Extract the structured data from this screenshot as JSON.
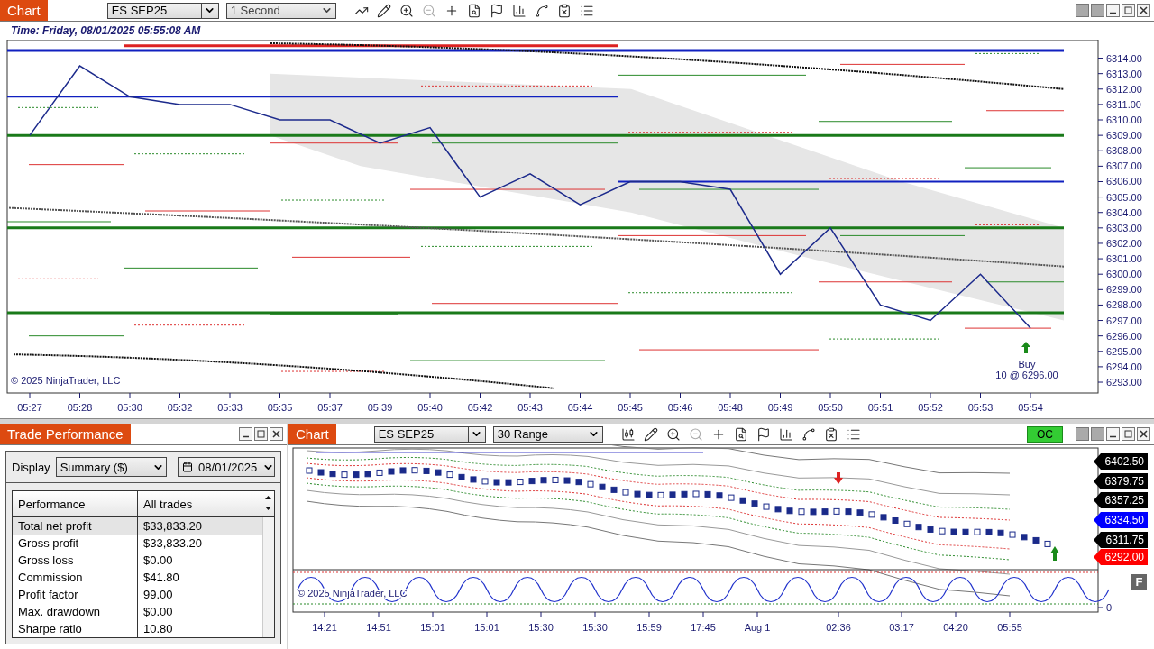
{
  "top_chart": {
    "tab": "Chart",
    "instrument": "ES SEP25",
    "interval": "1 Second",
    "time_label": "Time: Friday, 08/01/2025 05:55:08 AM",
    "copyright": "© 2025 NinjaTrader, LLC",
    "marker": {
      "label": "Buy",
      "detail": "10 @ 6296.00"
    },
    "chart_data": {
      "type": "line",
      "categories": [
        "05:27",
        "05:28",
        "05:30",
        "05:32",
        "05:33",
        "05:35",
        "05:37",
        "05:39",
        "05:40",
        "05:42",
        "05:43",
        "05:44",
        "05:45",
        "05:46",
        "05:48",
        "05:49",
        "05:50",
        "05:51",
        "05:52",
        "05:53",
        "05:54"
      ],
      "series": [
        {
          "color": "#1c2a8c",
          "values": [
            6309,
            6313.5,
            6311.5,
            6311,
            6311,
            6310,
            6310,
            6308.5,
            6309.5,
            6305,
            6306.5,
            6304.5,
            6306,
            6306,
            6305.5,
            6300,
            6303,
            6298,
            6297,
            6300,
            6296.5
          ]
        }
      ],
      "ylim": [
        6292.3,
        6315.2
      ],
      "yticks": [
        {
          "value": 6314,
          "label": "6314.00"
        },
        {
          "value": 6313,
          "label": "6313.00"
        },
        {
          "value": 6312,
          "label": "6312.00"
        },
        {
          "value": 6311,
          "label": "6311.00"
        },
        {
          "value": 6310,
          "label": "6310.00"
        },
        {
          "value": 6309,
          "label": "6309.00"
        },
        {
          "value": 6308,
          "label": "6308.00"
        },
        {
          "value": 6307,
          "label": "6307.00"
        },
        {
          "value": 6306,
          "label": "6306.00"
        },
        {
          "value": 6305,
          "label": "6305.00"
        },
        {
          "value": 6304,
          "label": "6304.00"
        },
        {
          "value": 6303,
          "label": "6303.00"
        },
        {
          "value": 6302,
          "label": "6302.00"
        },
        {
          "value": 6301,
          "label": "6301.00"
        },
        {
          "value": 6300,
          "label": "6300.00"
        },
        {
          "value": 6299,
          "label": "6299.00"
        },
        {
          "value": 6298,
          "label": "6298.00"
        },
        {
          "value": 6297,
          "label": "6297.00"
        },
        {
          "value": 6296,
          "label": "6296.00"
        },
        {
          "value": 6295,
          "label": "6295.00"
        },
        {
          "value": 6294,
          "label": "6294.00"
        },
        {
          "value": 6293,
          "label": "6293.00"
        }
      ]
    }
  },
  "performance": {
    "title": "Trade Performance",
    "display_label": "Display",
    "display_value": "Summary ($)",
    "date": "08/01/2025",
    "columns": [
      "Performance",
      "All trades"
    ],
    "rows": [
      {
        "label": "Total net profit",
        "value": "$33,833.20",
        "selected": true
      },
      {
        "label": "Gross profit",
        "value": "$33,833.20",
        "selected": false
      },
      {
        "label": "Gross loss",
        "value": "$0.00",
        "selected": false
      },
      {
        "label": "Commission",
        "value": "$41.80",
        "selected": false
      },
      {
        "label": "Profit factor",
        "value": "99.00",
        "selected": false
      },
      {
        "label": "Max. drawdown",
        "value": "$0.00",
        "selected": false
      },
      {
        "label": "Sharpe ratio",
        "value": "10.80",
        "selected": false
      }
    ]
  },
  "bottom_chart": {
    "tab": "Chart",
    "instrument": "ES SEP25",
    "interval": "30 Range",
    "oc_button": "OC",
    "copyright": "© 2025 NinjaTrader, LLC",
    "f_button": "F",
    "oscillator_tick": "0",
    "price_tags": [
      {
        "text": "6402.50",
        "color": "#000000"
      },
      {
        "text": "6379.75",
        "color": "#000000"
      },
      {
        "text": "6357.25",
        "color": "#000000"
      },
      {
        "text": "6334.50",
        "color": "#0000ff"
      },
      {
        "text": "6311.75",
        "color": "#000000"
      },
      {
        "text": "6292.00",
        "color": "#ff0000"
      }
    ],
    "time_labels": [
      "14:21",
      "14:51",
      "15:01",
      "15:01",
      "15:30",
      "15:30",
      "15:59",
      "17:45",
      "Aug 1",
      "02:36",
      "03:17",
      "04:20",
      "05:55"
    ]
  }
}
